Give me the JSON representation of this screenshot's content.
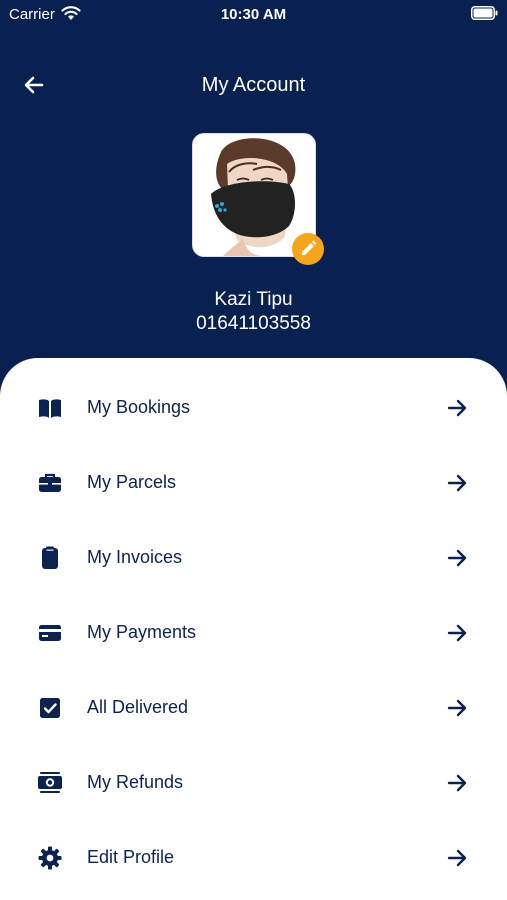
{
  "status_bar": {
    "carrier": "Carrier",
    "time": "10:30 AM"
  },
  "header": {
    "title": "My Account",
    "back_icon": "arrow-left-icon"
  },
  "profile": {
    "name": "Kazi Tipu",
    "phone": "01641103558",
    "edit_icon": "pencil-icon"
  },
  "colors": {
    "primary": "#082150",
    "accent": "#f7a51c",
    "sheet": "#ffffff"
  },
  "menu": [
    {
      "label": "My Bookings",
      "icon": "book-icon"
    },
    {
      "label": "My Parcels",
      "icon": "briefcase-icon"
    },
    {
      "label": "My Invoices",
      "icon": "clipboard-icon"
    },
    {
      "label": "My Payments",
      "icon": "credit-card-icon"
    },
    {
      "label": "All Delivered",
      "icon": "checkbox-icon"
    },
    {
      "label": "My Refunds",
      "icon": "money-icon"
    },
    {
      "label": "Edit Profile",
      "icon": "gear-icon"
    }
  ]
}
